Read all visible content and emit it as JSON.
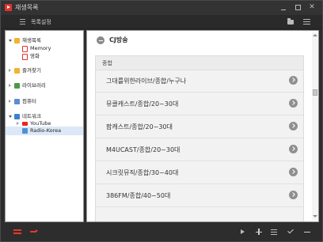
{
  "window": {
    "title": "재생목록"
  },
  "toolbar": {
    "list_settings_label": "목록설정"
  },
  "sidebar": {
    "items": [
      {
        "label": "재생목록",
        "icon": "playlist-folder-icon"
      },
      {
        "label": "Memory",
        "icon": "memory-icon"
      },
      {
        "label": "영화",
        "icon": "movie-icon"
      },
      {
        "label": "즐겨찾기",
        "icon": "favorites-icon"
      },
      {
        "label": "라이브러리",
        "icon": "library-icon"
      },
      {
        "label": "컴퓨터",
        "icon": "computer-icon"
      },
      {
        "label": "네트워크",
        "icon": "network-icon"
      },
      {
        "label": "YouTube",
        "icon": "youtube-icon"
      },
      {
        "label": "Radio-Korea",
        "icon": "radio-icon",
        "selected": true
      }
    ]
  },
  "main": {
    "header_title": "CJ방송",
    "category_label": "종합",
    "items": [
      {
        "label": "그대를위한라이브/종합/누구나"
      },
      {
        "label": "뮤클캐스트/종합/20~30대"
      },
      {
        "label": "팝캐스트/종합/20~30대"
      },
      {
        "label": "M4UCAST/종합/20~30대"
      },
      {
        "label": "시크릿뮤직/종합/30~40대"
      },
      {
        "label": "386FM/종합/40~50대"
      }
    ]
  },
  "colors": {
    "accent": "#e23a2e",
    "background": "#2d2d2d",
    "selection": "#dce8f7"
  }
}
